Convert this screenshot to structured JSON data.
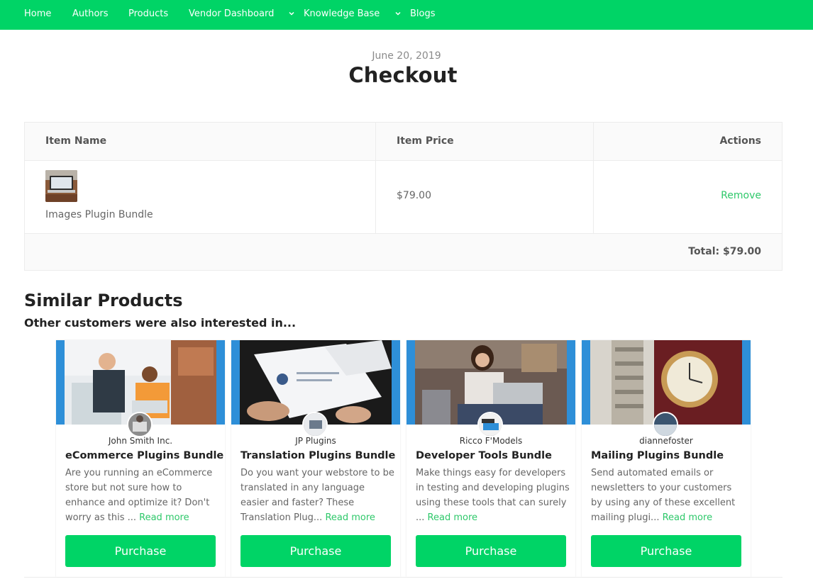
{
  "nav": {
    "items": [
      {
        "label": "Home"
      },
      {
        "label": "Authors"
      },
      {
        "label": "Products"
      },
      {
        "label": "Vendor Dashboard"
      },
      {
        "label": "Knowledge Base"
      },
      {
        "label": "Blogs"
      }
    ]
  },
  "page": {
    "date": "June 20, 2019",
    "title": "Checkout"
  },
  "cart": {
    "headers": {
      "name": "Item Name",
      "price": "Item Price",
      "actions": "Actions"
    },
    "items": [
      {
        "name": "Images Plugin Bundle",
        "price": "$79.00",
        "action": "Remove"
      }
    ],
    "total": "Total: $79.00"
  },
  "similar": {
    "title": "Similar Products",
    "subtitle": "Other customers were also interested in...",
    "products": [
      {
        "author": "John Smith Inc.",
        "title": "eCommerce Plugins Bundle",
        "desc": "Are you running an eCommerce store but not sure how to enhance and optimize it? Don't worry as this ...",
        "read_more": "Read more",
        "button": "Purchase"
      },
      {
        "author": "JP Plugins",
        "title": "Translation Plugins Bundle",
        "desc": "Do you want your webstore to be translated in any language easier and faster? These Translation Plug...",
        "read_more": "Read more",
        "button": "Purchase"
      },
      {
        "author": "Ricco F'Models",
        "title": "Developer Tools Bundle",
        "desc": "Make things easy for developers in testing and developing plugins using these tools that can surely ...",
        "read_more": "Read more",
        "button": "Purchase"
      },
      {
        "author": "diannefoster",
        "title": "Mailing Plugins Bundle",
        "desc": "Send automated emails or newsletters to your customers by using any of these excellent mailing plugi...",
        "read_more": "Read more",
        "button": "Purchase"
      }
    ]
  },
  "colors": {
    "accent": "#00d466",
    "link": "#2ec86a",
    "card_image_border": "#2e8fd8"
  }
}
